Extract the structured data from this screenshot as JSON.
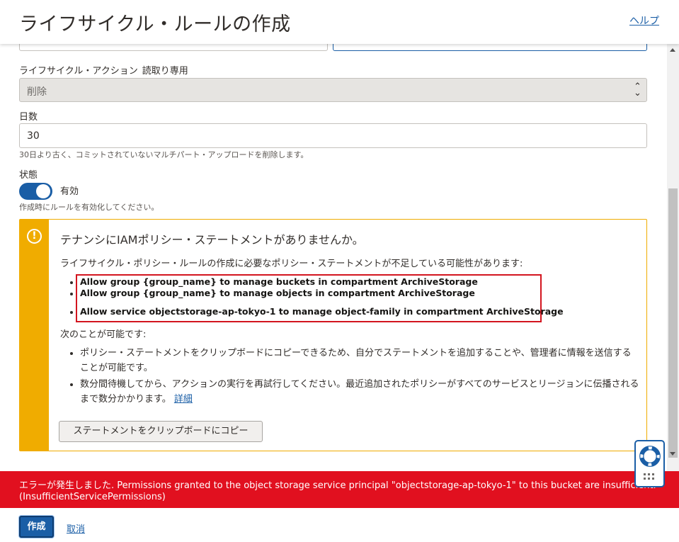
{
  "header": {
    "title": "ライフサイクル・ルールの作成",
    "help_link": "ヘルプ"
  },
  "form": {
    "action": {
      "label": "ライフサイクル・アクション",
      "readonly_note": "読取り専用",
      "value": "削除"
    },
    "days": {
      "label": "日数",
      "value": "30",
      "hint": "30日より古く、コミットされていないマルチパート・アップロードを削除します。"
    },
    "state": {
      "label": "状態",
      "toggle_label": "有効",
      "enabled": true,
      "hint": "作成時にルールを有効化してください。"
    }
  },
  "warning": {
    "title": "テナンシにIAMポリシー・ステートメントがありませんか。",
    "description": "ライフサイクル・ポリシー・ルールの作成に必要なポリシー・ステートメントが不足している可能性があります:",
    "policies": [
      "Allow group {group_name} to manage buckets in compartment ArchiveStorage",
      "Allow group {group_name} to manage objects in compartment ArchiveStorage",
      "Allow service objectstorage-ap-tokyo-1 to manage object-family in compartment ArchiveStorage"
    ],
    "can_do": "次のことが可能です:",
    "items": [
      {
        "text": "ポリシー・ステートメントをクリップボードにコピーできるため、自分でステートメントを追加することや、管理者に情報を送信することが可能です。"
      },
      {
        "text": "数分間待機してから、アクションの実行を再試行してください。最近追加されたポリシーがすべてのサービスとリージョンに伝播されるまで数分かかります。",
        "link": "詳細"
      }
    ],
    "copy_button": "ステートメントをクリップボードにコピー"
  },
  "error": {
    "line1": "エラーが発生しました. Permissions granted to the object storage service principal \"objectstorage-ap-tokyo-1\" to this bucket are insufficient.",
    "line2": "(InsufficientServicePermissions)"
  },
  "footer": {
    "create_button": "作成",
    "cancel_link": "取消"
  },
  "colors": {
    "accent": "#1a5ea6",
    "warning": "#f0ac00",
    "error": "#e1101f",
    "highlight_border": "#d3151f"
  }
}
